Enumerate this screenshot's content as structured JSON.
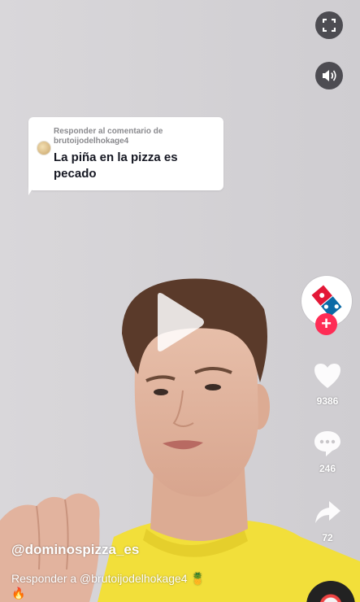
{
  "reply_bubble": {
    "header_line1": "Responder al comentario de",
    "header_line2": "brutoijodelhokage4",
    "text": "La piña en la pizza es pecado"
  },
  "actions": {
    "likes": "9386",
    "comments": "246",
    "shares": "72"
  },
  "author": {
    "username": "@dominospizza_es"
  },
  "caption": {
    "text": "Responder a @brutoijodelhokage4 🍍",
    "emoji_line": "🔥"
  },
  "colors": {
    "follow": "#fe2c55",
    "domino_blue": "#0b6aa6",
    "domino_red": "#e31837",
    "shirt": "#f2df3a"
  },
  "icons": [
    "fullscreen-icon",
    "volume-icon",
    "play-icon",
    "domino-logo",
    "plus-icon",
    "heart-icon",
    "comment-icon",
    "share-icon",
    "music-disc-icon",
    "fire-icon"
  ]
}
